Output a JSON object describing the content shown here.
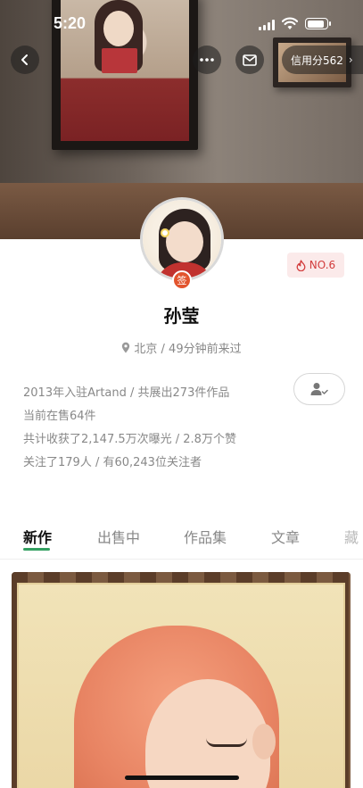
{
  "status_bar": {
    "time": "5:20"
  },
  "header": {
    "credit_label": "信用分562",
    "credit_chevron": "›",
    "back_icon": "chevron-left-icon",
    "more_icon": "more-dots-icon",
    "mail_icon": "mail-icon"
  },
  "profile": {
    "badge_label": "签",
    "rank_label": "NO.6",
    "name": "孙莹",
    "location": "北京 / 49分钟前来过",
    "stats": [
      "2013年入驻Artand / 共展出273件作品",
      "当前在售64件",
      "共计收获了2,147.5万次曝光 / 2.8万个赞",
      "关注了179人 / 有60,243位关注者"
    ]
  },
  "tabs": [
    {
      "label": "新作",
      "active": true
    },
    {
      "label": "出售中",
      "active": false
    },
    {
      "label": "作品集",
      "active": false
    },
    {
      "label": "文章",
      "active": false
    },
    {
      "label": "藏",
      "active": false
    }
  ],
  "colors": {
    "tab_indicator": "#33a061",
    "rank_text": "#d23b3b",
    "rank_bg": "#fbeaea",
    "sign_badge": "#e2542e"
  }
}
